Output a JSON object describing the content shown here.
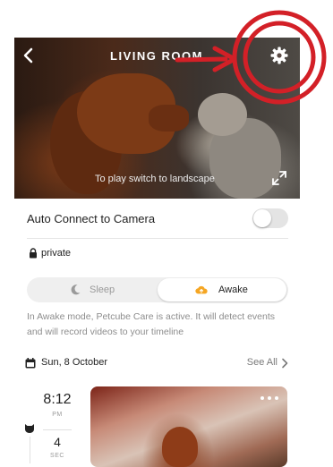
{
  "header": {
    "title": "LIVING ROOM",
    "back_icon": "chevron-left-icon",
    "settings_icon": "gear-icon"
  },
  "camera": {
    "hint": "To play switch to landscape",
    "expand_icon": "expand-icon"
  },
  "annotation": {
    "color": "#d32027"
  },
  "auto_connect": {
    "label": "Auto Connect to Camera",
    "enabled": false
  },
  "privacy": {
    "icon": "lock-icon",
    "label": "private"
  },
  "mode": {
    "sleep_label": "Sleep",
    "awake_label": "Awake",
    "selected": "Awake",
    "sleep_icon": "moon-icon",
    "awake_icon": "cloud-upload-icon",
    "awake_color": "#f5a623",
    "description": "In Awake mode, Petcube Care is active. It will detect events and will record videos to your timeline"
  },
  "timeline": {
    "date_icon": "calendar-icon",
    "date": "Sun, 8 October",
    "see_all": "See All",
    "events": [
      {
        "time": "8:12",
        "ampm": "PM",
        "duration": "4",
        "duration_unit": "SEC",
        "icon": "pet-icon"
      }
    ]
  }
}
